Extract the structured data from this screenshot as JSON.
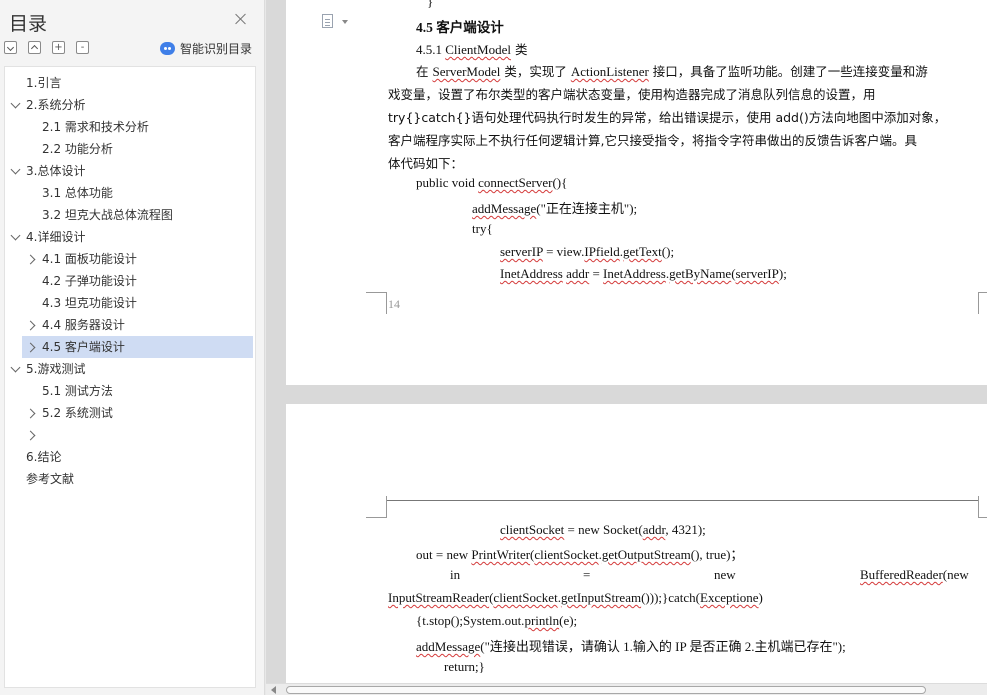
{
  "sidebar": {
    "title": "目录",
    "toolbar": {
      "collapse": "-",
      "expand": "+",
      "add": "+",
      "remove": "-"
    },
    "smart_toc_label": "智能识别目录",
    "items": [
      {
        "label": "1.引言"
      },
      {
        "label": "2.系统分析"
      },
      {
        "label": "2.1 需求和技术分析"
      },
      {
        "label": "2.2 功能分析"
      },
      {
        "label": "3.总体设计"
      },
      {
        "label": "3.1 总体功能"
      },
      {
        "label": "3.2 坦克大战总体流程图"
      },
      {
        "label": "4.详细设计"
      },
      {
        "label": "4.1 面板功能设计"
      },
      {
        "label": "4.2 子弹功能设计"
      },
      {
        "label": "4.3 坦克功能设计"
      },
      {
        "label": "4.4 服务器设计"
      },
      {
        "label": "4.5 客户端设计"
      },
      {
        "label": "5.游戏测试"
      },
      {
        "label": "5.1 测试方法"
      },
      {
        "label": "5.2 系统测试"
      },
      {
        "label": ""
      },
      {
        "label": "6.结论"
      },
      {
        "label": "参考文献"
      }
    ]
  },
  "document": {
    "page1": {
      "brace": "}",
      "heading": "4.5 客户端设计",
      "subheading_num": "4.5.1",
      "subheading_class": "ClientModel",
      "subheading_suffix": " 类",
      "para_l1_a": "在 ",
      "para_l1_b": "ServerModel",
      "para_l1_c": " 类，实现了 ",
      "para_l1_d": "ActionListener",
      "para_l1_e": " 接口，具备了监听功能。创建了一些连接变量和游",
      "para_l2": "戏变量，设置了布尔类型的客户端状态变量，使用构造器完成了消息队列信息的设置，用",
      "para_l3": "try{}catch{}语句处理代码执行时发生的异常，给出错误提示，使用 add()方法向地图中添加对象，",
      "para_l4": "客户端程序实际上不执行任何逻辑计算,它只接受指令，将指令字符串做出的反馈告诉客户端。具",
      "para_l5": "体代码如下：",
      "code1_a": "public void ",
      "code1_b": "connectServer",
      "code1_c": "(){",
      "code2_a": "addMessage",
      "code2_b": "(\"正在连接主机\");",
      "code3": "try{",
      "code4_a": "serverIP",
      "code4_b": " = view.",
      "code4_c": "IPfield",
      "code4_d": ".",
      "code4_e": "getText",
      "code4_f": "();",
      "code5_a": "InetAddress",
      "code5_b": " ",
      "code5_c": "addr",
      "code5_d": " = ",
      "code5_e": "InetAddress",
      "code5_f": ".",
      "code5_g": "getByName",
      "code5_h": "(",
      "code5_i": "serverIP",
      "code5_j": ");",
      "page_number": "14"
    },
    "page2": {
      "l1_a": "clientSocket",
      "l1_b": " = new Socket(",
      "l1_c": "addr",
      "l1_d": ", 4321);",
      "l2_a": "out = new ",
      "l2_b": "PrintWriter",
      "l2_c": "(",
      "l2_d": "clientSocket",
      "l2_e": ".",
      "l2_f": "getOutputStream",
      "l2_g": "(), true)；",
      "l3_in": "in",
      "l3_eq": "=",
      "l3_new": "new",
      "l3_buf": "BufferedReader",
      "l3_tail": "(new",
      "l4_a": "InputStreamReader",
      "l4_b": "(",
      "l4_c": "clientSocket",
      "l4_d": ".",
      "l4_e": "getInputStream",
      "l4_f": "()));}catch(",
      "l4_g": "Exceptione",
      "l4_h": ")",
      "l5_a": "{t.stop();System.out.",
      "l5_b": "println",
      "l5_c": "(e);",
      "l6_a": "addMessage",
      "l6_b": "(\"连接出现错误，请确认 1.输入的 IP 是否正确  2.主机端已存在\");",
      "l7": "return;}"
    }
  },
  "colors": {
    "selection": "#cfdcf3",
    "accent": "#3f7fe8",
    "spellcheck": "#d43a3a"
  },
  "icons": [
    "close-icon",
    "collapse-all-icon",
    "expand-all-icon",
    "add-icon",
    "remove-icon",
    "smart-toc-icon",
    "chevron-down-icon",
    "chevron-right-icon",
    "document-icon"
  ]
}
